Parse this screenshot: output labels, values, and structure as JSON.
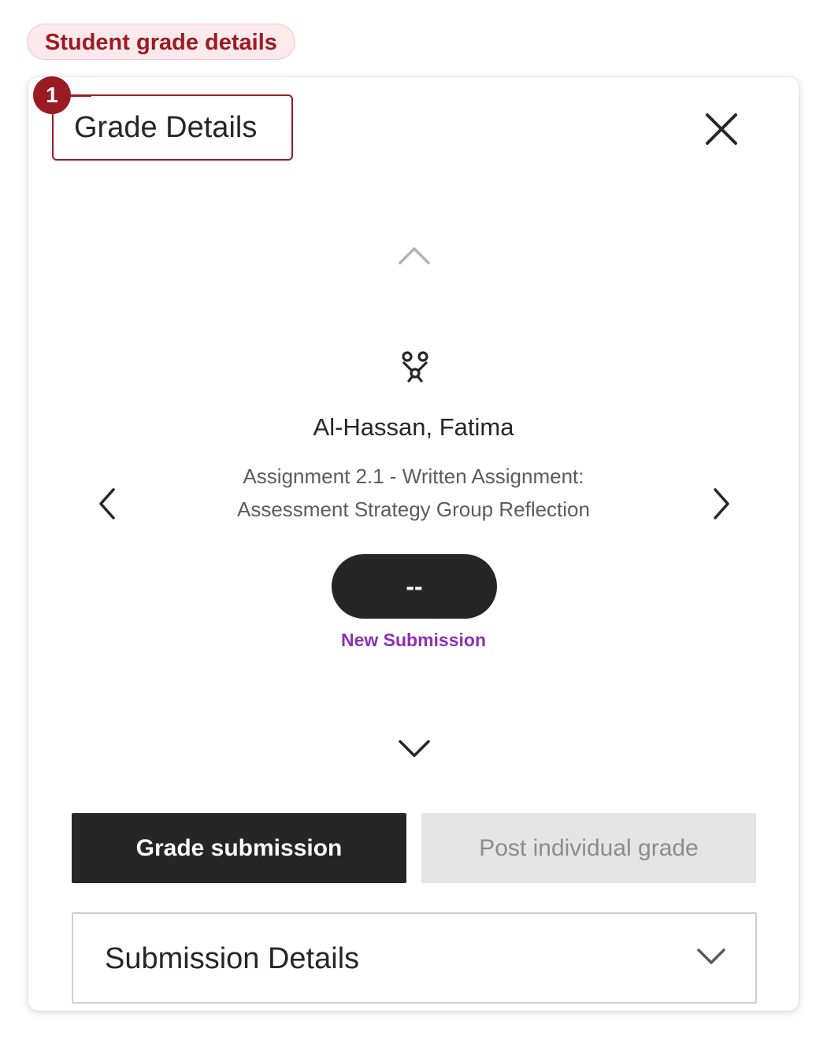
{
  "annotation": {
    "tag_label": "Student grade details",
    "callout_number": "1",
    "accent_color": "#9b1b22"
  },
  "panel": {
    "title": "Grade Details",
    "close_icon": "close-icon"
  },
  "navigation": {
    "up_icon": "chevron-up-icon",
    "down_icon": "chevron-down-icon",
    "prev_icon": "chevron-left-icon",
    "next_icon": "chevron-right-icon"
  },
  "student": {
    "avatar_icon": "group-avatar-icon",
    "name": "Al-Hassan, Fatima",
    "assignment_line1": "Assignment 2.1 - Written Assignment:",
    "assignment_line2": "Assessment Strategy Group Reflection",
    "grade": "--",
    "status": "New Submission",
    "status_color": "#8f2fb5"
  },
  "actions": {
    "grade_submission": "Grade submission",
    "post_individual_grade": "Post individual grade"
  },
  "submission_details": {
    "label": "Submission Details",
    "chevron_icon": "chevron-down-icon"
  }
}
